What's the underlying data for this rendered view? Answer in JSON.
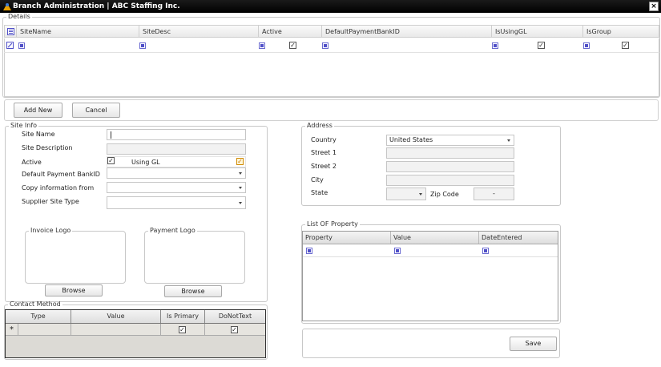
{
  "window": {
    "title": "Branch Administration | ABC Staffing Inc.",
    "close_label": "×"
  },
  "details": {
    "legend": "Details",
    "columns": [
      "SiteName",
      "SiteDesc",
      "Active",
      "DefaultPaymentBankID",
      "IsUsingGL",
      "IsGroup"
    ],
    "row": {
      "active_checked": true,
      "isusinggl_checked": true,
      "isgroup_checked": true
    },
    "buttons": {
      "add_new": "Add New",
      "cancel": "Cancel"
    }
  },
  "site_info": {
    "legend": "Site Info",
    "site_name_label": "Site Name",
    "site_name_value": "",
    "site_description_label": "Site Description",
    "site_description_value": "",
    "active_label": "Active",
    "active_checked": true,
    "using_gl_label": "Using GL",
    "using_gl_checked": true,
    "default_payment_bank_label": "Default Payment BankID",
    "default_payment_bank_value": "",
    "copy_information_label": "Copy information from",
    "copy_information_value": "",
    "supplier_site_type_label": "Supplier Site Type",
    "supplier_site_type_value": "",
    "invoice_logo_legend": "Invoice Logo",
    "payment_logo_legend": "Payment Logo",
    "browse_label": "Browse"
  },
  "contact_method": {
    "legend": "Contact Method",
    "columns": [
      "Type",
      "Value",
      "Is Primary",
      "DoNotText"
    ],
    "new_row_marker": "*"
  },
  "address": {
    "legend": "Address",
    "country_label": "Country",
    "country_value": "United States",
    "street1_label": "Street 1",
    "street1_value": "",
    "street2_label": "Street 2",
    "street2_value": "",
    "city_label": "City",
    "city_value": "",
    "state_label": "State",
    "state_value": "",
    "zip_label": "Zip Code",
    "zip_value": "-"
  },
  "list_of_property": {
    "legend": "List OF Property",
    "columns": [
      "Property",
      "Value",
      "DateEntered"
    ]
  },
  "save_label": "Save"
}
